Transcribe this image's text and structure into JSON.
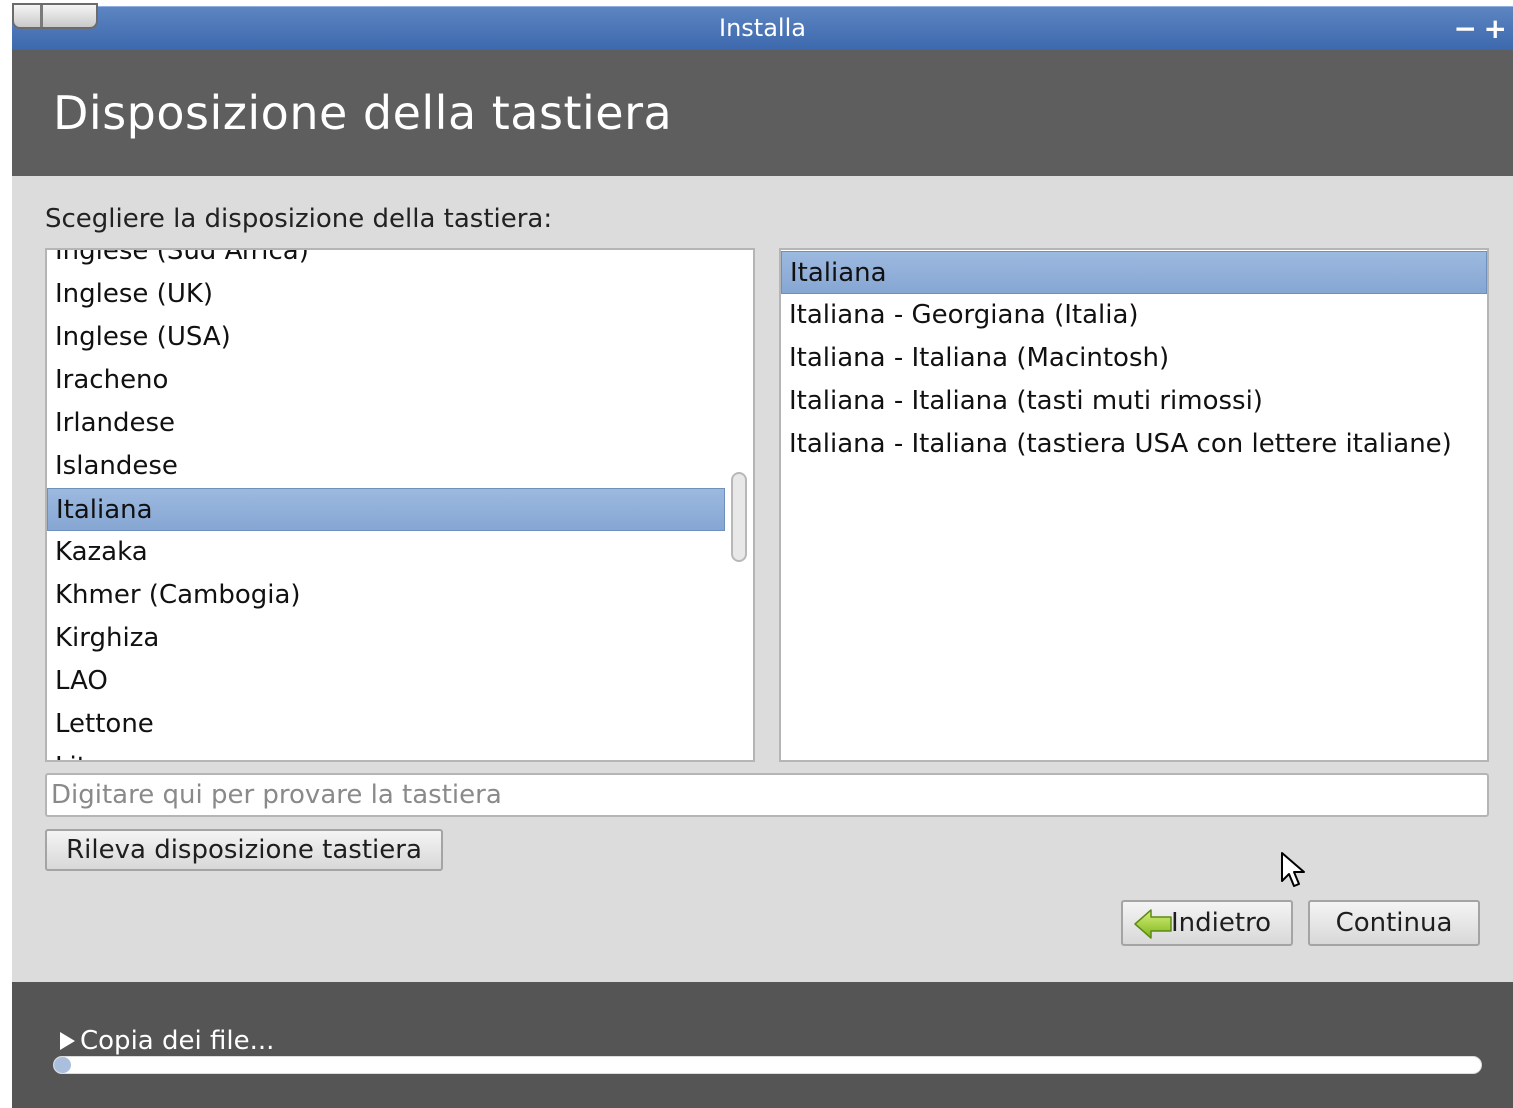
{
  "window": {
    "title": "Installa",
    "minimize_label": "−",
    "maximize_label": "+"
  },
  "header": {
    "title": "Disposizione della tastiera"
  },
  "main": {
    "prompt": "Scegliere la disposizione della tastiera:",
    "layouts": {
      "selected": "Italiana",
      "items": [
        "Inglese (Sud Africa)",
        "Inglese (UK)",
        "Inglese (USA)",
        "Iracheno",
        "Irlandese",
        "Islandese",
        "Italiana",
        "Kazaka",
        "Khmer (Cambogia)",
        "Kirghiza",
        "LAO",
        "Lettone",
        "Lituana"
      ]
    },
    "variants": {
      "selected": "Italiana",
      "items": [
        "Italiana",
        "Italiana - Georgiana (Italia)",
        "Italiana - Italiana (Macintosh)",
        "Italiana - Italiana (tasti muti rimossi)",
        "Italiana - Italiana (tastiera USA con lettere italiane)"
      ]
    },
    "test_input": {
      "placeholder": "Digitare qui per provare la tastiera",
      "value": ""
    },
    "detect_button": "Rileva disposizione tastiera"
  },
  "buttons": {
    "back": "Indietro",
    "back_icon": "green-left-arrow-icon",
    "continue": "Continua"
  },
  "footer": {
    "progress_label": "Copia dei file...",
    "progress_fraction": 0.01
  },
  "colors": {
    "titlebar": "#4a74b6",
    "header": "#5e5e5e",
    "selection": "#90add7",
    "footer": "#555555"
  }
}
